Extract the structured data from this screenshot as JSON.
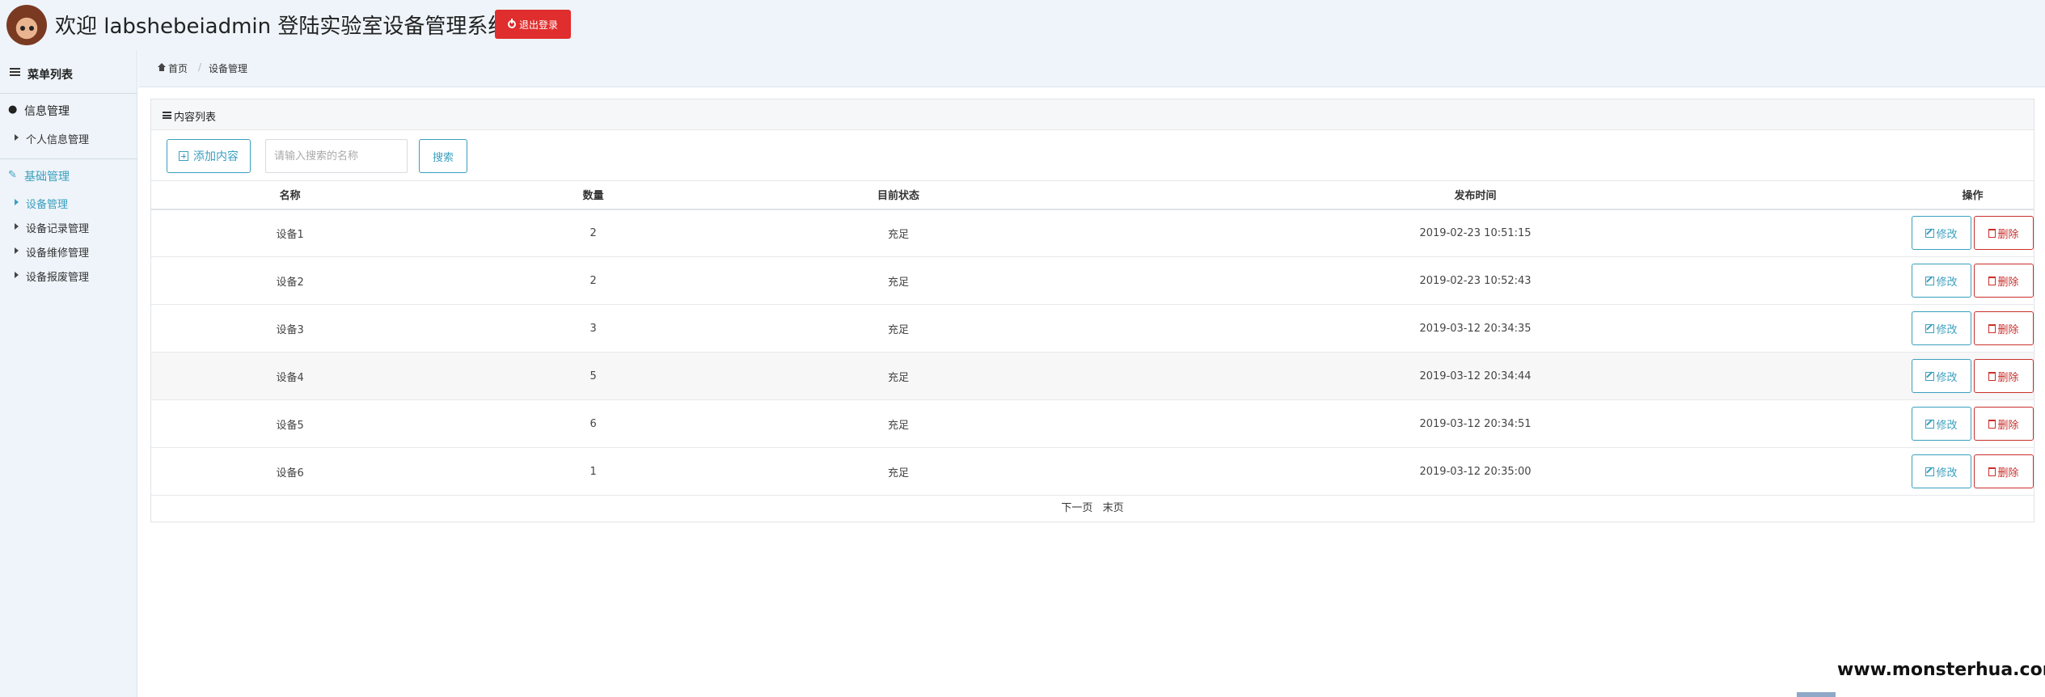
{
  "header": {
    "title": "欢迎 labshebeiadmin 登陆实验室设备管理系统",
    "logout_label": "退出登录"
  },
  "sidebar": {
    "heading": "菜单列表",
    "sections": [
      {
        "label": "信息管理",
        "icon": "user-icon",
        "items": [
          "个人信息管理"
        ]
      },
      {
        "label": "基础管理",
        "icon": "edit-icon",
        "items": [
          "设备管理",
          "设备记录管理",
          "设备维修管理",
          "设备报废管理"
        ]
      }
    ],
    "active_color": "#3a9fbf"
  },
  "breadcrumb": {
    "home": "首页",
    "current": "设备管理"
  },
  "panel": {
    "title": "内容列表",
    "add_label": "添加内容",
    "search_placeholder": "请输入搜索的名称",
    "search_label": "搜索"
  },
  "table": {
    "headers": [
      "名称",
      "数量",
      "目前状态",
      "发布时间",
      "操作"
    ],
    "rows": [
      {
        "name": "设备1",
        "qty": "2",
        "status": "充足",
        "time": "2019-02-23 10:51:15"
      },
      {
        "name": "设备2",
        "qty": "2",
        "status": "充足",
        "time": "2019-02-23 10:52:43"
      },
      {
        "name": "设备3",
        "qty": "3",
        "status": "充足",
        "time": "2019-03-12 20:34:35"
      },
      {
        "name": "设备4",
        "qty": "5",
        "status": "充足",
        "time": "2019-03-12 20:34:44"
      },
      {
        "name": "设备5",
        "qty": "6",
        "status": "充足",
        "time": "2019-03-12 20:34:51"
      },
      {
        "name": "设备6",
        "qty": "1",
        "status": "充足",
        "time": "2019-03-12 20:35:00"
      }
    ],
    "edit_label": "修改",
    "delete_label": "删除"
  },
  "pager": {
    "next": "下一页",
    "last": "末页"
  },
  "watermark": "www.monsterhua.com",
  "colors": {
    "accent": "#3a9fbf",
    "danger": "#e02d2d",
    "background": "#eef4f9"
  }
}
